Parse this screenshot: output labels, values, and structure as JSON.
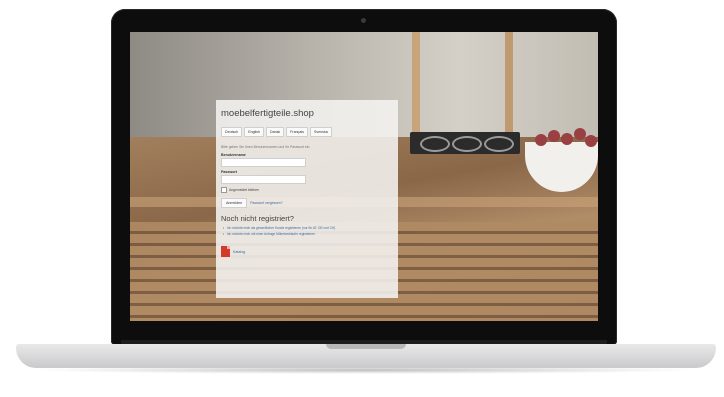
{
  "site": {
    "title": "moebelfertigteile.shop"
  },
  "languages": [
    "Deutsch",
    "English",
    "Dansk",
    "Français",
    "Svenska"
  ],
  "login": {
    "hint": "Bitte geben Sie Ihren Benutzernamen und Ihr Passwort ein.",
    "username_label": "Benutzername",
    "password_label": "Passwort",
    "remember_label": "Angemeldet bleiben",
    "submit_label": "Anmelden",
    "forgot_label": "Passwort vergessen?"
  },
  "register": {
    "title": "Noch nicht registriert?",
    "options": [
      "Ich möchte mich als gewerblicher Kunde registrieren (nur für AT, DE und CH)",
      "Ich möchte mich mit einer Anfrage Möbelverkäufer registrieren"
    ]
  },
  "catalog": {
    "label": "Katalog",
    "icon": "pdf-icon"
  }
}
